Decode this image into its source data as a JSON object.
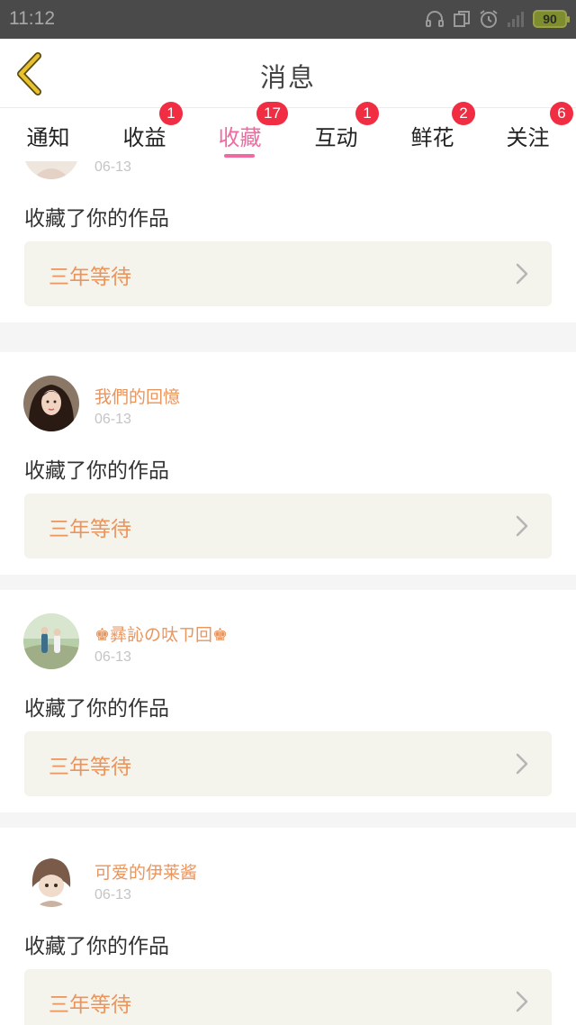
{
  "status_bar": {
    "time": "11:12",
    "battery": "90",
    "icons": [
      "headset-icon",
      "sim-icon",
      "alarm-icon",
      "signal-icon",
      "battery-icon"
    ]
  },
  "header": {
    "title": "消息",
    "back_icon": "back-chevron-icon",
    "back_color": "#e8c22e"
  },
  "tabs": [
    {
      "label": "通知",
      "badge": "",
      "active": false
    },
    {
      "label": "收益",
      "badge": "1",
      "active": false
    },
    {
      "label": "收藏",
      "badge": "17",
      "active": true
    },
    {
      "label": "互动",
      "badge": "1",
      "active": false
    },
    {
      "label": "鲜花",
      "badge": "2",
      "active": false
    },
    {
      "label": "关注",
      "badge": "6",
      "active": false
    }
  ],
  "colors": {
    "accent_pink": "#ef6aa0",
    "badge_red": "#f02d42",
    "username_orange": "#e9955e",
    "work_bg": "#f4f3ec"
  },
  "messages": [
    {
      "username": "",
      "date": "06-13",
      "action": "收藏了你的作品",
      "work_title": "三年等待"
    },
    {
      "username": "我們的回憶",
      "date": "06-13",
      "action": "收藏了你的作品",
      "work_title": "三年等待"
    },
    {
      "username": "♚彞訫の呔ㄗ回♚",
      "date": "06-13",
      "action": "收藏了你的作品",
      "work_title": "三年等待"
    },
    {
      "username": "可爱的伊莱酱",
      "date": "06-13",
      "action": "收藏了你的作品",
      "work_title": "三年等待"
    }
  ]
}
